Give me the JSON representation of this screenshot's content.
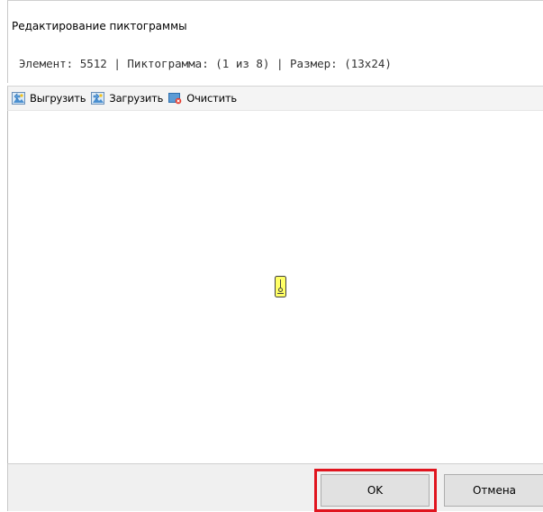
{
  "dialog": {
    "title": "Редактирование пиктограммы",
    "info": "Элемент: 5512 | Пиктограмма: (1 из 8) | Размер: (13x24)"
  },
  "toolbar": {
    "items": [
      {
        "label": "Выгрузить",
        "icon": "export-image-icon"
      },
      {
        "label": "Загрузить",
        "icon": "import-image-icon"
      },
      {
        "label": "Очистить",
        "icon": "clear-image-icon"
      }
    ]
  },
  "pictogram": {
    "fill": "#ffff66",
    "stroke": "#404040"
  },
  "footer": {
    "ok_label": "OK",
    "cancel_label": "Отмена",
    "highlight_color": "#e0141e"
  }
}
